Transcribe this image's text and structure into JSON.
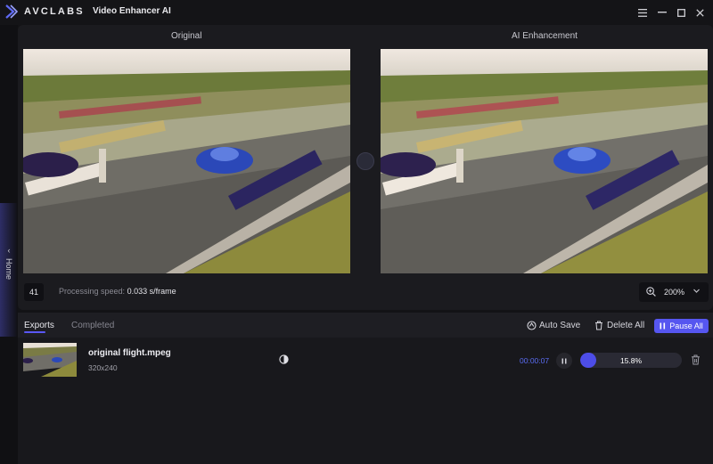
{
  "titlebar": {
    "brand": "AVCLABS",
    "app_title": "Video Enhancer AI",
    "icons": [
      "menu-icon",
      "minimize-icon",
      "maximize-icon",
      "close-icon"
    ]
  },
  "sidebar": {
    "home_label": "Home"
  },
  "preview": {
    "original_label": "Original",
    "enhanced_label": "AI Enhancement",
    "frame_number": "41",
    "speed_label": "Processing speed:",
    "speed_value": "0.033",
    "speed_unit": "s/frame",
    "zoom": "200%"
  },
  "exports": {
    "tabs": [
      {
        "label": "Exports",
        "active": true
      },
      {
        "label": "Completed",
        "active": false
      }
    ],
    "auto_save_label": "Auto Save",
    "delete_all_label": "Delete All",
    "pause_all_label": "Pause All",
    "items": [
      {
        "filename": "original flight.mpeg",
        "resolution": "320x240",
        "elapsed": "00:00:07",
        "progress_label": "15.8%",
        "progress": 0.158
      }
    ]
  },
  "colors": {
    "accent": "#5656f0",
    "bg": "#131316",
    "panel": "#1b1b1f"
  }
}
